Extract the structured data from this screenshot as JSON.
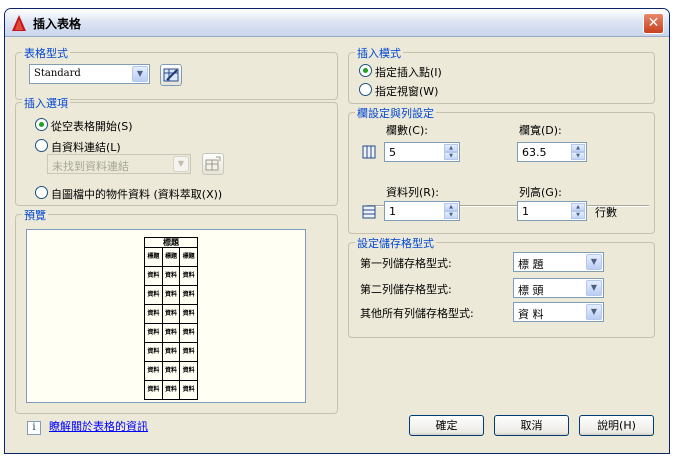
{
  "window": {
    "title": "插入表格",
    "close_glyph": "✕"
  },
  "table_style": {
    "group_title": "表格型式",
    "selected": "Standard"
  },
  "insert_options": {
    "group_title": "插入選項",
    "option_empty": "從空表格開始(S)",
    "option_data_link": "自資料連結(L)",
    "data_link_combo": "未找到資料連結",
    "option_object_data": "自圖檔中的物件資料 (資料萃取(X))"
  },
  "preview": {
    "group_title": "預覽",
    "table_title": "標題",
    "header_row": [
      "標題",
      "標題",
      "標題"
    ],
    "data_cell": "資料",
    "data_row_count": 7
  },
  "insertion_behavior": {
    "group_title": "插入模式",
    "option_point": "指定插入點(I)",
    "option_window": "指定視窗(W)"
  },
  "column_row": {
    "group_title": "欄設定與列設定",
    "columns_label": "欄數(C):",
    "columns_value": "5",
    "column_width_label": "欄寬(D):",
    "column_width_value": "63.5",
    "data_rows_label": "資料列(R):",
    "data_rows_value": "1",
    "row_height_label": "列高(G):",
    "row_height_value": "1",
    "row_height_unit": "行數"
  },
  "cell_styles": {
    "group_title": "設定儲存格型式",
    "first_row_label": "第一列儲存格型式:",
    "first_row_value": "標 題",
    "second_row_label": "第二列儲存格型式:",
    "second_row_value": "標 頭",
    "other_rows_label": "其他所有列儲存格型式:",
    "other_rows_value": "資 料"
  },
  "footer": {
    "info_glyph": "i",
    "help_link": "瞭解關於表格的資訊",
    "ok": "確定",
    "cancel": "取消",
    "help": "說明(H)"
  },
  "colors": {
    "group_title": "#0046d5",
    "link": "#0000ff",
    "title_close": "#c8401e"
  },
  "icons": [
    "app-icon",
    "table-style-dialog-icon",
    "data-link-manager-icon",
    "columns-icon",
    "rows-icon",
    "info-icon",
    "dropdown-arrow-icon",
    "spinner-icon"
  ]
}
